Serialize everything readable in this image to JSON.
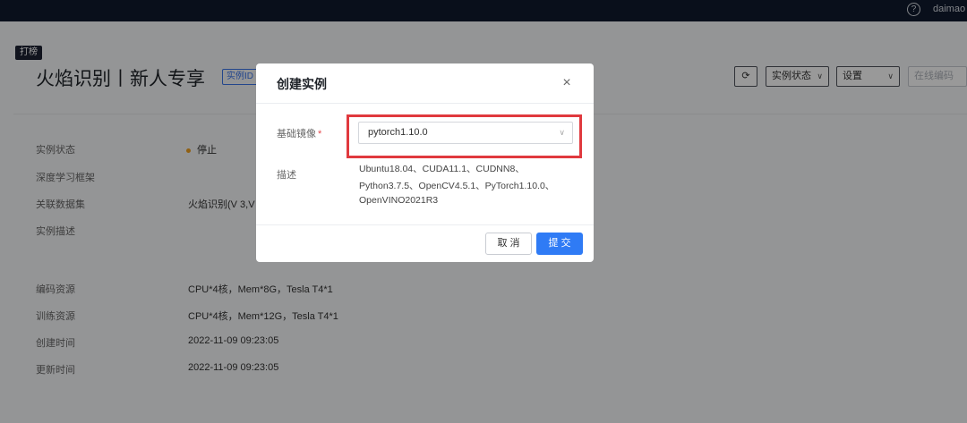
{
  "topbar": {
    "help_icon": "?",
    "username": "daimao"
  },
  "page": {
    "tag": "打榜",
    "title": "火焰识别丨新人专享",
    "id_tag": "实例ID",
    "toolbar": {
      "refresh_icon": "⟳",
      "status_label": "实例状态",
      "settings_label": "设置",
      "online_label": "在线编码",
      "caret": "∨"
    },
    "info": {
      "status_label": "实例状态",
      "status_value": "停止",
      "framework_label": "深度学习框架",
      "dataset_label": "关联数据集",
      "dataset_value": "火焰识别(V 3,V",
      "desc_label": "实例描述",
      "coding_label": "编码资源",
      "coding_value": "CPU*4核，Mem*8G，Tesla T4*1",
      "training_label": "训练资源",
      "training_value": "CPU*4核，Mem*12G，Tesla T4*1",
      "created_label": "创建时间",
      "created_value": "2022-11-09 09:23:05",
      "updated_label": "更新时间",
      "updated_value": "2022-11-09 09:23:05"
    }
  },
  "modal": {
    "title": "创建实例",
    "close_icon": "×",
    "image_label": "基础镜像",
    "required_mark": "*",
    "image_value": "pytorch1.10.0",
    "chevron": "∨",
    "desc_label": "描述",
    "desc_lines": [
      "Ubuntu18.04、CUDA11.1、CUDNN8、",
      "Python3.7.5、OpenCV4.5.1、PyTorch1.10.0、",
      "OpenVINO2021R3"
    ],
    "cancel_label": "取 消",
    "submit_label": "提 交"
  },
  "colors": {
    "primary": "#2f7bf5",
    "highlight": "#e0393e",
    "status_stopped": "#f0a020",
    "topbar": "#101a2e"
  }
}
